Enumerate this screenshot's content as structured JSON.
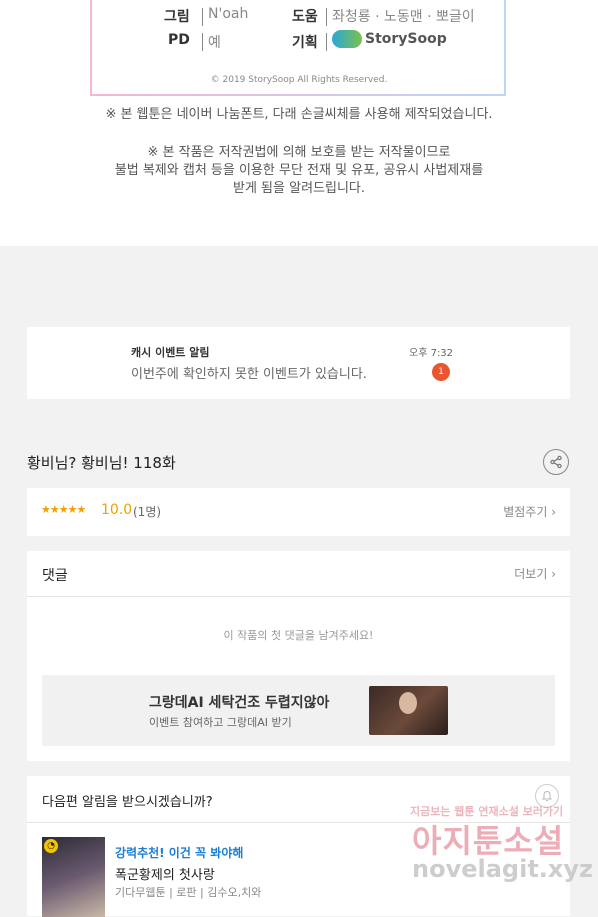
{
  "credits": {
    "art_label": "그림",
    "art_value": "N'oah",
    "help_label": "도움",
    "help_value": "좌청룡 · 노동맨 · 뽀글이",
    "pd_label": "PD",
    "pd_value": "예",
    "plan_label": "기획",
    "plan_value": "StorySoop",
    "copyright": "© 2019 StorySoop All Rights Reserved."
  },
  "notices": {
    "font_notice": "※ 본 웹툰은 네이버 나눔폰트, 다래 손글씨체를 사용해 제작되었습니다.",
    "copyright_notice_1": "※ 본 작품은 저작권법에 의해 보호를 받는 저작물이므로",
    "copyright_notice_2": "불법 복제와 캡처 등을 이용한 무단 전재 및 유포, 공유시 사법제재를",
    "copyright_notice_3": "받게 됨을 알려드립니다."
  },
  "event": {
    "title": "캐시 이벤트 알림",
    "subtitle": "이번주에 확인하지 못한 이벤트가 있습니다.",
    "time": "오후 7:32",
    "badge": "1"
  },
  "episode": {
    "title": "황비님? 황비님! 118화"
  },
  "rating": {
    "stars": "★★★★★",
    "score": "10.0",
    "count": "(1명)",
    "rate_link": "별점주기 ›"
  },
  "comments": {
    "header": "댓글",
    "more": "더보기 ›",
    "empty": "이 작품의 첫 댓글을 남겨주세요!"
  },
  "ad": {
    "title": "그랑데AI 세탁건조 두렵지않아",
    "subtitle": "이벤트 참여하고 그랑데AI 받기"
  },
  "next_alert": {
    "question": "다음편 알림을 받으시겠습니까?",
    "rec_label": "강력추천! 이건 꼭 봐야해",
    "rec_title": "폭군황제의 첫사랑",
    "rec_meta": "기다무웹툰 | 로판 | 김수오,치와",
    "thumb_badge": "◔"
  },
  "watermark": {
    "line1": "지금보는 웹툰 연재소설 보러가기",
    "line2": "아지툰소설",
    "line3": "novelagit.xyz"
  },
  "colors": {
    "accent_orange": "#f0a000",
    "badge_red": "#e8552f",
    "link_blue": "#1a7fd4"
  }
}
